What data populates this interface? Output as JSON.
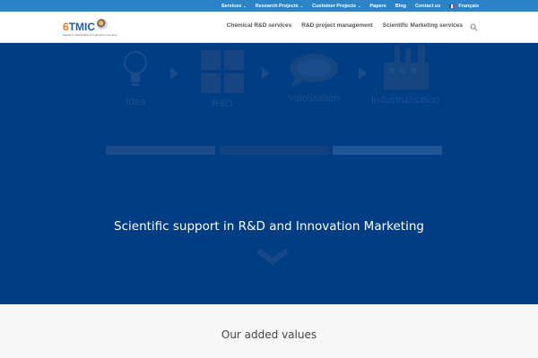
{
  "top_nav": {
    "items": [
      {
        "label": "Services",
        "dropdown": true
      },
      {
        "label": "Research Projects",
        "dropdown": true
      },
      {
        "label": "Customer Projects",
        "dropdown": true
      },
      {
        "label": "Papers",
        "dropdown": false
      },
      {
        "label": "Blog",
        "dropdown": false
      },
      {
        "label": "Contact us",
        "dropdown": false
      }
    ],
    "language": "Français",
    "language_icon": "french-flag-icon"
  },
  "header": {
    "logo_text_prefix": "6",
    "logo_text": "TMIC",
    "logo_tagline": "Solutions Industrielles et Ingénierie Innovante",
    "nav_items": [
      "Chemical R&D services",
      "R&D project management",
      "Scientific Marketing services"
    ],
    "search_icon": "search-icon"
  },
  "hero": {
    "steps": [
      {
        "label": "Idea",
        "icon": "lightbulb-icon"
      },
      {
        "label": "R&D",
        "icon": "grid-icon"
      },
      {
        "label": "Valorisation",
        "icon": "speech-bubble-icon"
      },
      {
        "label": "Industrialisation",
        "icon": "factory-icon"
      }
    ],
    "tagline": "Scientific support in R&D and Innovation Marketing",
    "scroll_icon": "chevron-down-icon"
  },
  "values_section": {
    "title": "Our added values"
  },
  "colors": {
    "top_bar": "#2c83c5",
    "hero_bg": "#013d83",
    "nav_text": "#555555",
    "section_bg": "#f7f7f7"
  }
}
